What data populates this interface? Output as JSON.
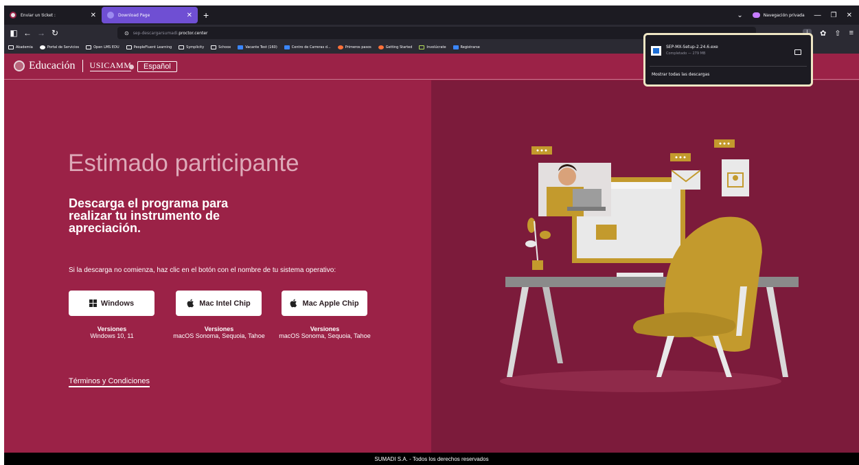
{
  "browser": {
    "tabs": [
      {
        "title": "Enviar un ticket :",
        "active": false
      },
      {
        "title": "Download Page",
        "active": true
      }
    ],
    "new_tab": "+",
    "private_label": "Navegación privada",
    "window_controls": {
      "minimize": "—",
      "restore": "❐",
      "close": "✕"
    },
    "url": {
      "prefix": "sep-descargarsumadi.",
      "host": "proctor.center"
    },
    "bookmarks": [
      "Akademia",
      "Portal de Servicios",
      "Open LMS EDU",
      "PeopleFluent Learning",
      "Symplicity",
      "Schoox",
      "Vacante Test (160)",
      "Centro de Carreras d...",
      "Primeros pasos",
      "Getting Started",
      "Involúcrate",
      "Registrarse"
    ]
  },
  "downloads": {
    "file_name": "SEP-MX-Setup-2.24.6.exe",
    "status": "Completado — 279 MB",
    "show_all": "Mostrar todas las descargas"
  },
  "site": {
    "logo_text": "Educación",
    "logo_subtext": "USICAMM",
    "language": "Español"
  },
  "main": {
    "heading": "Estimado participante",
    "subheading": "Descarga el programa para realizar tu instrumento de apreciación.",
    "instructions": "Si la descarga no comienza, haz clic en el botón con el nombre de tu sistema operativo:",
    "buttons": [
      {
        "label": "Windows",
        "icon": "windows-icon"
      },
      {
        "label": "Mac Intel Chip",
        "icon": "apple-icon"
      },
      {
        "label": "Mac Apple Chip",
        "icon": "apple-icon"
      }
    ],
    "versions": [
      {
        "title": "Versiones",
        "text": "Windows 10, 11"
      },
      {
        "title": "Versiones",
        "text": "macOS Sonoma, Sequoia, Tahoe"
      },
      {
        "title": "Versiones",
        "text": "macOS Sonoma, Sequoia, Tahoe"
      }
    ],
    "terms": "Términos y Condiciones"
  },
  "footer": {
    "text": "SUMADI S.A. - Todos los derechos reservados"
  },
  "colors": {
    "left_panel": "#9b2247",
    "right_panel": "#7c1b3b",
    "accent_gold": "#c39a2d",
    "heading": "#dda9b8"
  }
}
